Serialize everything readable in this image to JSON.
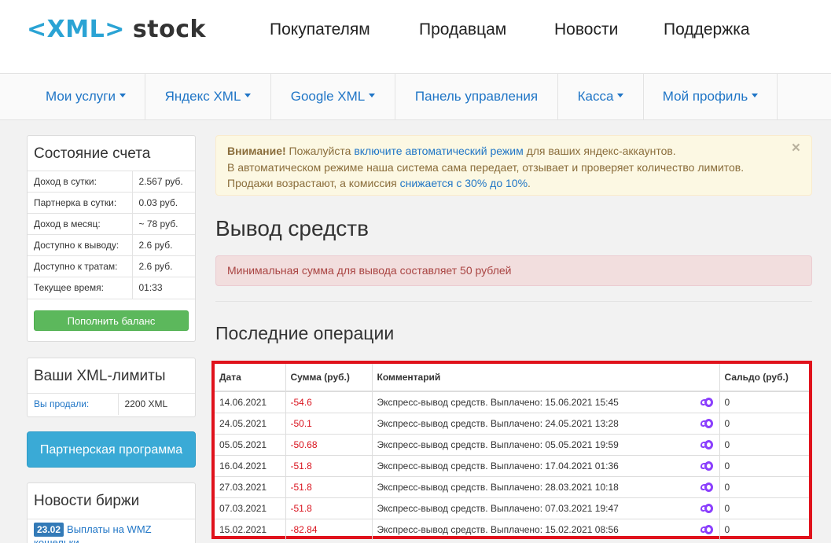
{
  "logo": {
    "lt": "<",
    "xml": "XML",
    "gt": ">",
    "stock": "stock"
  },
  "topnav": [
    "Покупателям",
    "Продавцам",
    "Новости",
    "Поддержка"
  ],
  "menu": [
    "Мои услуги",
    "Яндекс XML",
    "Google XML",
    "Панель управления",
    "Касса",
    "Мой профиль"
  ],
  "account": {
    "title": "Состояние счета",
    "rows": [
      {
        "label": "Доход в сутки:",
        "value": "2.567 руб."
      },
      {
        "label": "Партнерка в сутки:",
        "value": "0.03 руб."
      },
      {
        "label": "Доход в месяц:",
        "value": "~ 78 руб."
      },
      {
        "label": "Доступно к выводу:",
        "value": "2.6 руб."
      },
      {
        "label": "Доступно к тратам:",
        "value": "2.6 руб."
      },
      {
        "label": "Текущее время:",
        "value": "01:33"
      }
    ],
    "topup_button": "Пополнить баланс"
  },
  "limits": {
    "title": "Ваши XML-лимиты",
    "sold_label": "Вы продали:",
    "sold_value": "2200 XML"
  },
  "partner_button": "Партнерская программа",
  "news": {
    "title": "Новости биржи",
    "item_date": "23.02",
    "item_text": "Выплаты на WMZ кошельки"
  },
  "warning": {
    "strong": "Внимание!",
    "t1": " Пожалуйста ",
    "link1": "включите автоматический режим",
    "t2": " для ваших яндекс-аккаунтов.",
    "line2": "В автоматическом режиме наша система сама передает, отзывает и проверяет количество лимитов.",
    "t3": "Продажи возрастают, а комиссия ",
    "link2": "снижается с 30% до 10%",
    "t4": ".",
    "close": "×"
  },
  "page_title": "Вывод средств",
  "min_notice": "Минимальная сумма для вывода составляет 50 рублей",
  "ops": {
    "title": "Последние операции",
    "headers": [
      "Дата",
      "Сумма (руб.)",
      "Комментарий",
      "Сальдо (руб.)"
    ],
    "rows": [
      {
        "date": "14.06.2021",
        "sum": "-54.6",
        "comment": "Экспресс-вывод средств. Выплачено: 15.06.2021 15:45",
        "saldo": "0"
      },
      {
        "date": "24.05.2021",
        "sum": "-50.1",
        "comment": "Экспресс-вывод средств. Выплачено: 24.05.2021 13:28",
        "saldo": "0"
      },
      {
        "date": "05.05.2021",
        "sum": "-50.68",
        "comment": "Экспресс-вывод средств. Выплачено: 05.05.2021 19:59",
        "saldo": "0"
      },
      {
        "date": "16.04.2021",
        "sum": "-51.8",
        "comment": "Экспресс-вывод средств. Выплачено: 17.04.2021 01:36",
        "saldo": "0"
      },
      {
        "date": "27.03.2021",
        "sum": "-51.8",
        "comment": "Экспресс-вывод средств. Выплачено: 28.03.2021 10:18",
        "saldo": "0"
      },
      {
        "date": "07.03.2021",
        "sum": "-51.8",
        "comment": "Экспресс-вывод средств. Выплачено: 07.03.2021 19:47",
        "saldo": "0"
      },
      {
        "date": "15.02.2021",
        "sum": "-82.84",
        "comment": "Экспресс-вывод средств. Выплачено: 15.02.2021 08:56",
        "saldo": "0"
      }
    ]
  }
}
